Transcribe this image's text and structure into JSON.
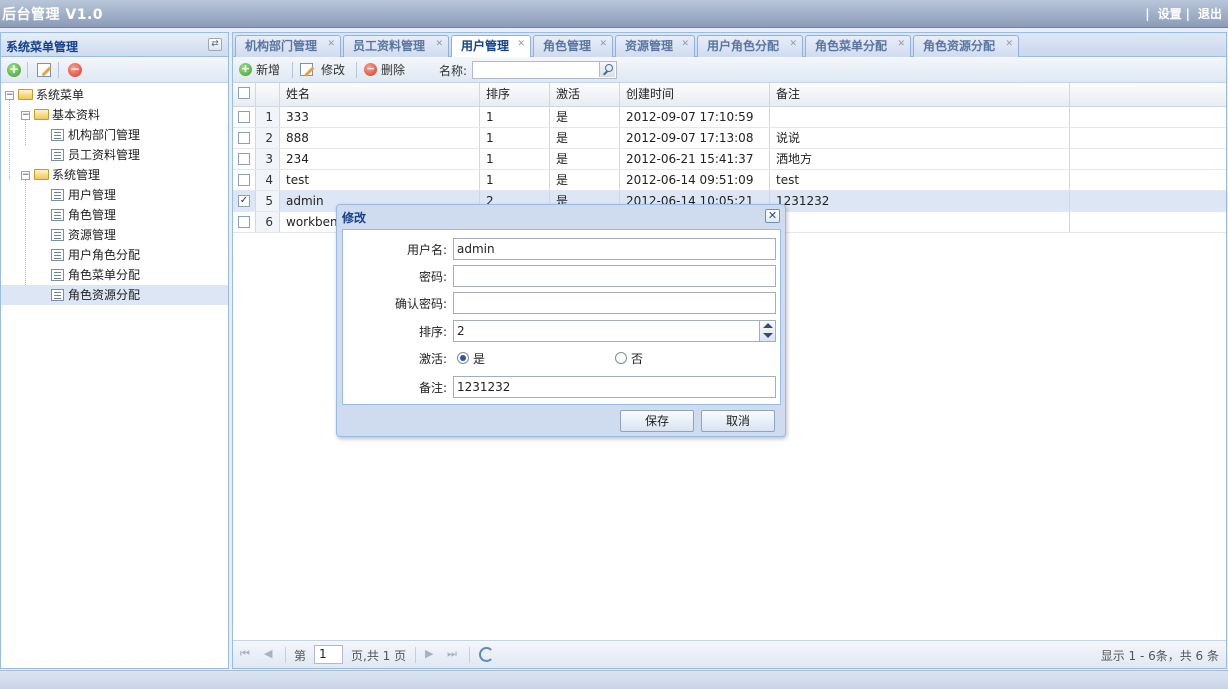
{
  "header": {
    "app_title": "后台管理 V1.0",
    "settings_link": "设置",
    "logout_link": "退出",
    "separator": "|"
  },
  "sidebar": {
    "title": "系统菜单管理",
    "tree": {
      "root": "系统菜单",
      "groups": [
        {
          "label": "基本资料",
          "items": [
            "机构部门管理",
            "员工资料管理"
          ]
        },
        {
          "label": "系统管理",
          "items": [
            "用户管理",
            "角色管理",
            "资源管理",
            "用户角色分配",
            "角色菜单分配",
            "角色资源分配"
          ]
        }
      ],
      "selected_item": "角色资源分配"
    }
  },
  "tabs": [
    {
      "label": "机构部门管理",
      "active": false
    },
    {
      "label": "员工资料管理",
      "active": false
    },
    {
      "label": "用户管理",
      "active": true
    },
    {
      "label": "角色管理",
      "active": false
    },
    {
      "label": "资源管理",
      "active": false
    },
    {
      "label": "用户角色分配",
      "active": false
    },
    {
      "label": "角色菜单分配",
      "active": false
    },
    {
      "label": "角色资源分配",
      "active": false
    }
  ],
  "toolbar": {
    "add_label": "新增",
    "edit_label": "修改",
    "delete_label": "删除",
    "search_label": "名称:",
    "search_value": ""
  },
  "grid": {
    "columns": [
      "姓名",
      "排序",
      "激活",
      "创建时间",
      "备注"
    ],
    "rows": [
      {
        "num": "1",
        "name": "333",
        "order": "1",
        "active": "是",
        "created": "2012-09-07 17:10:59",
        "remark": "",
        "checked": false
      },
      {
        "num": "2",
        "name": "888",
        "order": "1",
        "active": "是",
        "created": "2012-09-07 17:13:08",
        "remark": "说说",
        "checked": false
      },
      {
        "num": "3",
        "name": "234",
        "order": "1",
        "active": "是",
        "created": "2012-06-21 15:41:37",
        "remark": "洒地方",
        "checked": false
      },
      {
        "num": "4",
        "name": "test",
        "order": "1",
        "active": "是",
        "created": "2012-06-14 09:51:09",
        "remark": "test",
        "checked": false
      },
      {
        "num": "5",
        "name": "admin",
        "order": "2",
        "active": "是",
        "created": "2012-06-14 10:05:21",
        "remark": "1231232",
        "checked": true
      },
      {
        "num": "6",
        "name": "workbench",
        "order": "",
        "active": "",
        "created": "",
        "remark": "",
        "checked": false
      }
    ]
  },
  "pager": {
    "page_prefix": "第",
    "page_value": "1",
    "page_suffix": "页,共 1 页",
    "info": "显示 1 - 6条，共 6 条"
  },
  "dialog": {
    "title": "修改",
    "close_glyph": "✕",
    "fields": {
      "username_label": "用户名:",
      "username_value": "admin",
      "password_label": "密码:",
      "password_value": "",
      "confirm_label": "确认密码:",
      "confirm_value": "",
      "order_label": "排序:",
      "order_value": "2",
      "active_label": "激活:",
      "active_yes": "是",
      "active_no": "否",
      "remark_label": "备注:",
      "remark_value": "1231232"
    },
    "save_label": "保存",
    "cancel_label": "取消"
  },
  "colors": {
    "accent": "#15428b",
    "border": "#99bbe8",
    "selected_row": "#dce6f4"
  }
}
